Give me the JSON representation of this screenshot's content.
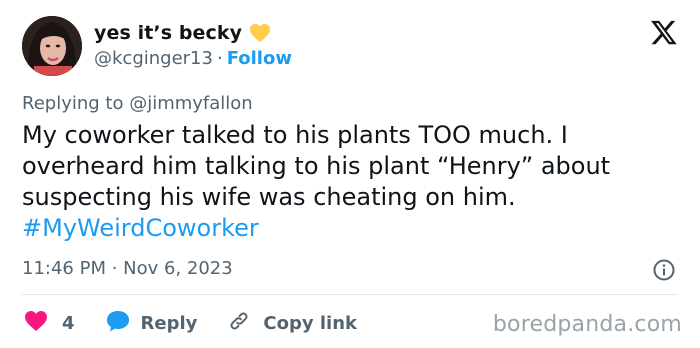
{
  "author": {
    "display_name": "yes it’s becky",
    "handle": "@kcginger13",
    "separator": "·",
    "follow_label": "Follow"
  },
  "reply_context": "Replying to @jimmyfallon",
  "tweet": {
    "text": "My coworker talked to his plants TOO much. I overheard him talking to his plant “Henry” about suspecting his wife was cheating on him.",
    "hashtag": "#MyWeirdCoworker",
    "timestamp": "11:46 PM · Nov 6, 2023"
  },
  "actions": {
    "like_count": "4",
    "reply_label": "Reply",
    "copy_link_label": "Copy link"
  },
  "watermark": "boredpanda.com",
  "colors": {
    "accent": "#1d9bf0",
    "like": "#f91880",
    "muted": "#536471",
    "heart_emoji": "#ffcc4d"
  },
  "icons": {
    "avatar": "profile-photo",
    "badge": "yellow-heart-icon",
    "brand": "x-logo-icon",
    "info": "info-icon",
    "like": "heart-icon",
    "reply": "speech-bubble-icon",
    "copy_link": "link-icon"
  }
}
